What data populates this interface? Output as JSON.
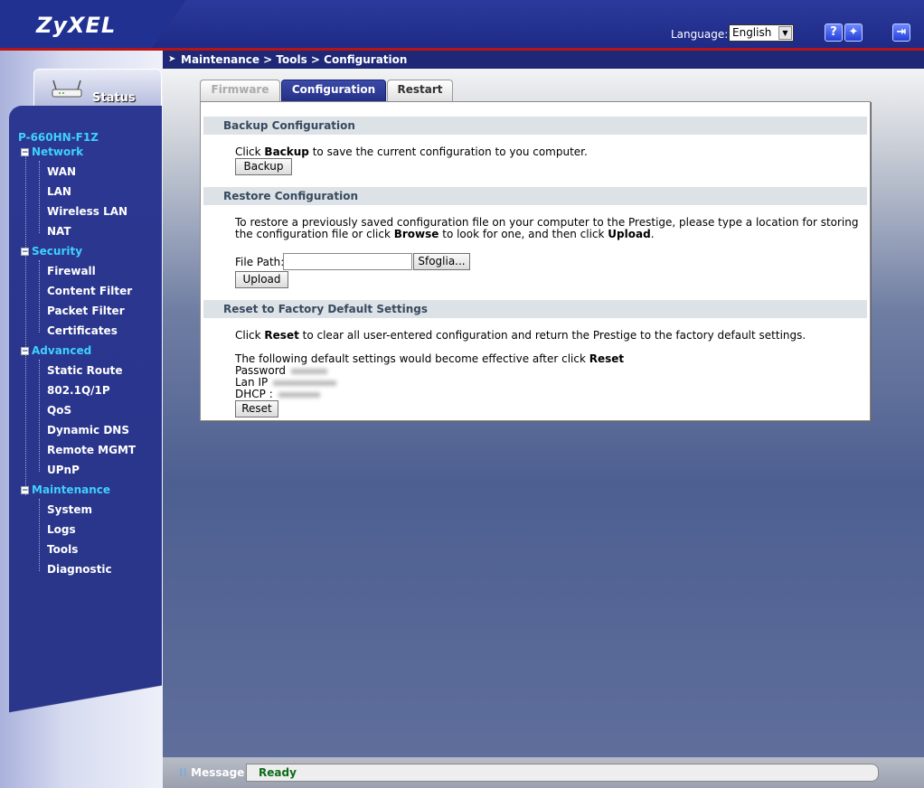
{
  "header": {
    "logo": "ZyXEL",
    "language_label": "Language:",
    "language_value": "English",
    "help_icon": "?",
    "wizard_icon": "✦",
    "logout_icon": "⇥"
  },
  "sidebar": {
    "status_label": "Status",
    "model": "P-660HN-F1Z",
    "groups": [
      {
        "label": "Network",
        "items": [
          "WAN",
          "LAN",
          "Wireless LAN",
          "NAT"
        ]
      },
      {
        "label": "Security",
        "items": [
          "Firewall",
          "Content Filter",
          "Packet Filter",
          "Certificates"
        ]
      },
      {
        "label": "Advanced",
        "items": [
          "Static Route",
          "802.1Q/1P",
          "QoS",
          "Dynamic DNS",
          "Remote MGMT",
          "UPnP"
        ]
      },
      {
        "label": "Maintenance",
        "items": [
          "System",
          "Logs",
          "Tools",
          "Diagnostic"
        ]
      }
    ]
  },
  "breadcrumb": "Maintenance > Tools > Configuration",
  "tabs": [
    "Firmware",
    "Configuration",
    "Restart"
  ],
  "backup": {
    "heading": "Backup Configuration",
    "text_pre": "Click ",
    "text_bold": "Backup",
    "text_post": " to save the current configuration to you computer.",
    "button": "Backup"
  },
  "restore": {
    "heading": "Restore Configuration",
    "line1": "To restore a previously saved configuration file on your computer to the Prestige, please type a location for storing",
    "line2_pre": "the configuration file or click ",
    "line2_bold1": "Browse",
    "line2_mid": " to look for one, and then click ",
    "line2_bold2": "Upload",
    "line2_post": ".",
    "file_path_label": "File Path:",
    "browse_button": "Sfoglia...",
    "upload_button": "Upload"
  },
  "reset": {
    "heading": "Reset to Factory Default Settings",
    "text_pre": "Click ",
    "text_bold": "Reset",
    "text_post": " to clear all user-entered configuration and return the Prestige to the factory default settings.",
    "defaults_pre": "The following default settings would become effective after click ",
    "defaults_bold": "Reset",
    "password_label": "Password",
    "lanip_label": "Lan IP",
    "dhcp_label": "DHCP :",
    "button": "Reset"
  },
  "footer": {
    "message_label": "Message",
    "message_value": "Ready"
  }
}
